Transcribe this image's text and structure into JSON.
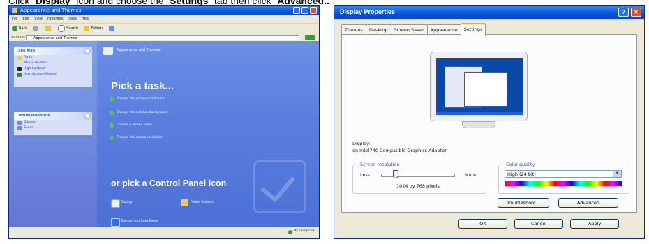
{
  "instruction": {
    "part1": "Click “",
    "display_word": "Display",
    "part2": "” icon and choose the “",
    "settings_word": "Settings",
    "part3": "” tab then click “",
    "advanced_word": "Advanced..",
    "part4": "”."
  },
  "left_window": {
    "title": "Appearance and Themes",
    "menu": [
      "File",
      "Edit",
      "View",
      "Favorites",
      "Tools",
      "Help"
    ],
    "toolbar": [
      "Back",
      "Search",
      "Folders"
    ],
    "address_label": "Address",
    "address_value": "Appearance and Themes",
    "see_also_header": "See Also",
    "see_also_items": [
      "Fonts",
      "Mouse Pointers",
      "High Contrast",
      "User Account Picture"
    ],
    "troubleshooters_header": "Troubleshooters",
    "troubleshooters_items": [
      "Display",
      "Sound"
    ],
    "category_header": "Appearance and Themes",
    "pick_task_title": "Pick a task...",
    "tasks": [
      "Change the computer's theme",
      "Change the desktop background",
      "Choose a screen saver",
      "Change the screen resolution"
    ],
    "pick_icon_title": "or pick a Control Panel icon",
    "icons": [
      "Display",
      "Folder Options",
      "Taskbar and Start Menu"
    ],
    "status_zone": "My Computer"
  },
  "dialog": {
    "title": "Display Properties",
    "help_symbol": "?",
    "close_symbol": "✕",
    "tabs": [
      "Themes",
      "Desktop",
      "Screen Saver",
      "Appearance",
      "Settings"
    ],
    "active_tab": "Settings",
    "display_label": "Display:",
    "display_adapter": "on Intel740 Compatible Graphics Adapter",
    "resolution_group": "Screen resolution",
    "resolution_less": "Less",
    "resolution_more": "More",
    "resolution_value": "1024 by 768 pixels",
    "color_group": "Color quality",
    "color_value": "High (24 bit)",
    "troubleshoot_button": "Troubleshoot...",
    "advanced_button": "Advanced",
    "ok_button": "OK",
    "cancel_button": "Cancel",
    "apply_button": "Apply"
  },
  "colors": {
    "xp_blue": "#0a53d6",
    "task_panel_blue": "#5b7fdf",
    "dialog_face": "#ece9d8",
    "active_tab_accent": "#f2a33a"
  }
}
